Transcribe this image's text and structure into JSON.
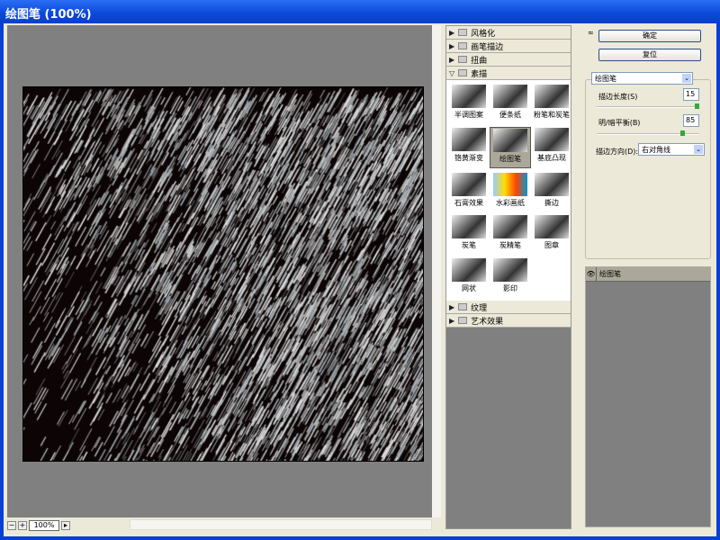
{
  "window": {
    "title": "绘图笔 (100%)"
  },
  "preview": {
    "zoom": "100%",
    "zoom_out": "−",
    "zoom_in": "+",
    "zoom_menu": "▸"
  },
  "categories_top": [
    {
      "label": "风格化"
    },
    {
      "label": "画笔描边"
    },
    {
      "label": "扭曲"
    },
    {
      "label": "素描",
      "expanded": true
    }
  ],
  "filters": [
    {
      "label": "半调图案"
    },
    {
      "label": "便条纸"
    },
    {
      "label": "粉笔和炭笔"
    },
    {
      "label": "铬黄渐变"
    },
    {
      "label": "绘图笔",
      "selected": true
    },
    {
      "label": "基底凸现"
    },
    {
      "label": "石膏效果"
    },
    {
      "label": "水彩画纸"
    },
    {
      "label": "撕边"
    },
    {
      "label": "炭笔"
    },
    {
      "label": "炭精笔"
    },
    {
      "label": "图章"
    },
    {
      "label": "网状"
    },
    {
      "label": "影印"
    }
  ],
  "categories_bottom": [
    {
      "label": "纹理"
    },
    {
      "label": "艺术效果"
    }
  ],
  "buttons": {
    "ok": "确定",
    "reset": "复位",
    "collapse": "≈"
  },
  "settings": {
    "filter": "绘图笔",
    "stroke_length_label": "描边长度(S)",
    "stroke_length": "15",
    "stroke_length_max": 15,
    "balance_label": "明/暗平衡(B)",
    "balance": "85",
    "balance_max": 100,
    "direction_label": "描边方向(D):",
    "direction": "右对角线"
  },
  "layers": [
    {
      "label": "绘图笔",
      "visible": true
    }
  ]
}
